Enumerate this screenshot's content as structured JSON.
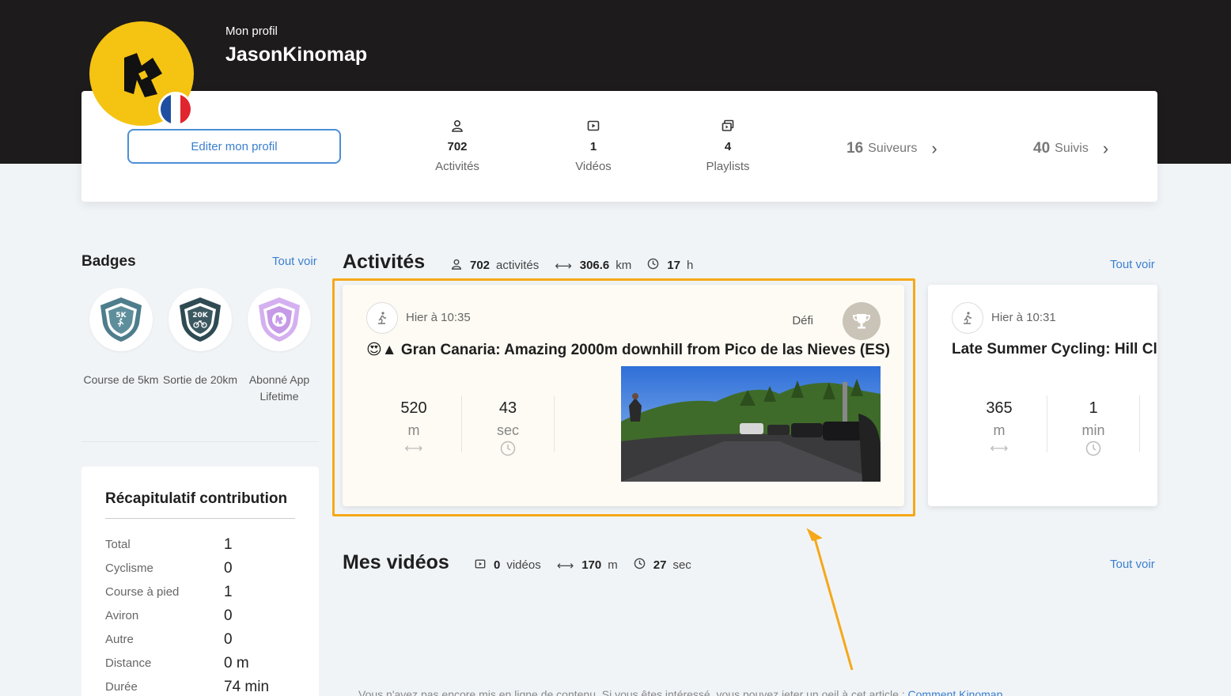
{
  "profile": {
    "label": "Mon profil",
    "username": "JasonKinomap",
    "edit_button": "Editer mon profil",
    "stats": [
      {
        "icon": "user-icon",
        "value": "702",
        "label": "Activités"
      },
      {
        "icon": "video-icon",
        "value": "1",
        "label": "Vidéos"
      },
      {
        "icon": "playlist-icon",
        "value": "4",
        "label": "Playlists"
      }
    ],
    "followers": {
      "count": "16",
      "label": "Suiveurs"
    },
    "following": {
      "count": "40",
      "label": "Suivis"
    }
  },
  "badges": {
    "title": "Badges",
    "see_all": "Tout voir",
    "items": [
      {
        "code": "5K",
        "label": "Course de 5km",
        "color": "#4e7d8c"
      },
      {
        "code": "20K",
        "label": "Sortie de 20km",
        "color": "#2f4a52"
      },
      {
        "code": "",
        "label": "Abonné App Lifetime",
        "color": "#c79ae8"
      }
    ]
  },
  "recap": {
    "title": "Récapitulatif contribution",
    "rows": [
      {
        "label": "Total",
        "value": "1"
      },
      {
        "label": "Cyclisme",
        "value": "0"
      },
      {
        "label": "Course à pied",
        "value": "1"
      },
      {
        "label": "Aviron",
        "value": "0"
      },
      {
        "label": "Autre",
        "value": "0"
      },
      {
        "label": "Distance",
        "value": "0 m"
      },
      {
        "label": "Durée",
        "value": "74 min"
      }
    ]
  },
  "activities": {
    "title": "Activités",
    "see_all": "Tout voir",
    "summary": {
      "count": "702",
      "count_unit": "activités",
      "distance": "306.6",
      "distance_unit": "km",
      "duration": "17",
      "duration_unit": "h"
    },
    "cards": [
      {
        "time": "Hier à 10:35",
        "tag": "Défi",
        "title": "😍▲ Gran Canaria: Amazing 2000m downhill from Pico de las Nieves (ES)",
        "distance": "520",
        "distance_unit": "m",
        "duration": "43",
        "duration_unit": "sec"
      },
      {
        "time": "Hier à 10:31",
        "title": "Late Summer Cycling: Hill Climb",
        "distance": "365",
        "distance_unit": "m",
        "duration": "1",
        "duration_unit": "min"
      }
    ]
  },
  "videos": {
    "title": "Mes vidéos",
    "see_all": "Tout voir",
    "summary": {
      "count": "0",
      "count_unit": "vidéos",
      "distance": "170",
      "distance_unit": "m",
      "duration": "27",
      "duration_unit": "sec"
    },
    "empty_text": "Vous n'avez pas encore mis en ligne de contenu. Si vous êtes intéressé, vous pouvez jeter un oeil à cet article : ",
    "empty_link": "Comment Kinomap"
  },
  "colors": {
    "accent": "#3a7fcf",
    "highlight": "#f5a818",
    "brand": "#f5c312"
  }
}
